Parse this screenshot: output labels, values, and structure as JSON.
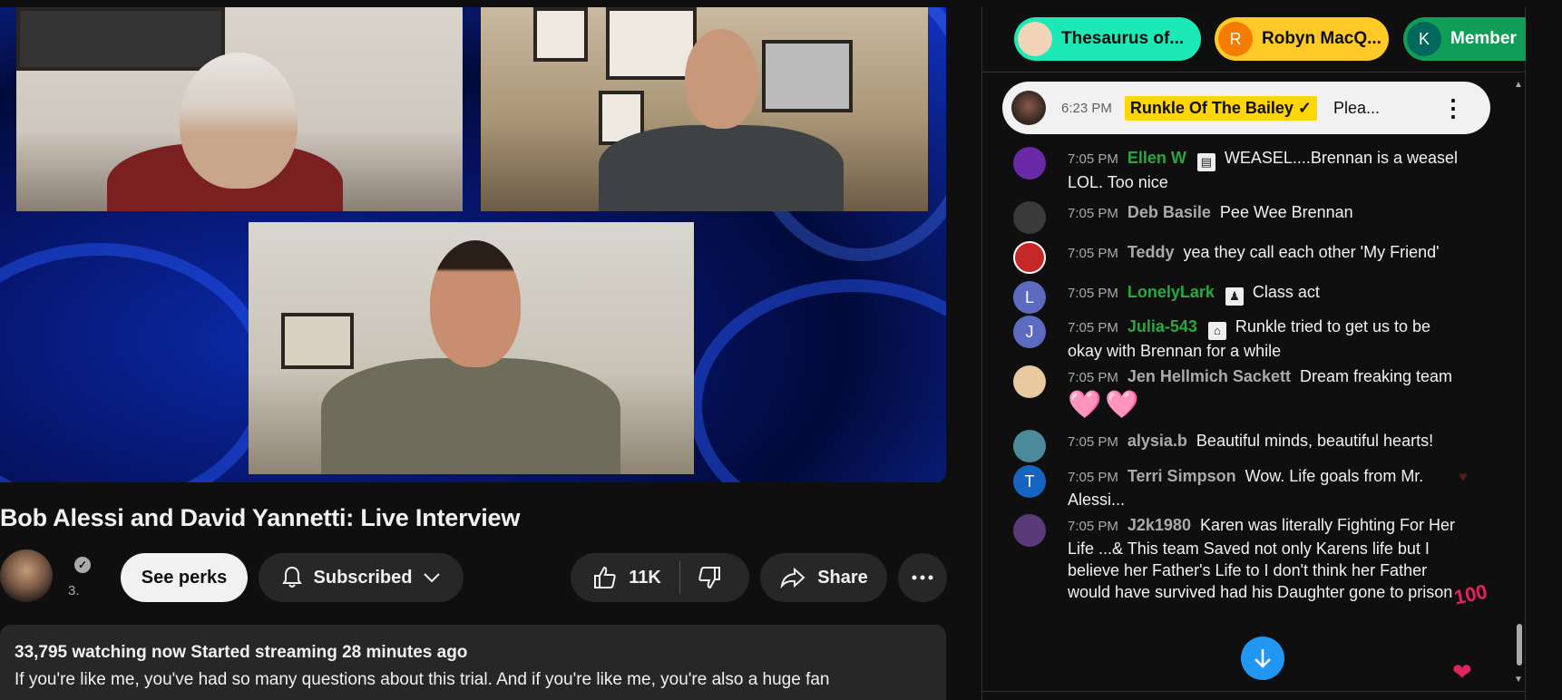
{
  "video": {
    "title": "Bob Alessi and David Yannetti: Live Interview",
    "channel_subs_fragment": "3.",
    "see_perks_label": "See perks",
    "subscribed_label": "Subscribed",
    "like_count": "11K",
    "share_label": "Share",
    "description": {
      "stats": "33,795 watching now  Started streaming 28 minutes ago",
      "text": "If you're like me, you've had so many questions about this trial.  And if you're like me, you're also a huge fan"
    }
  },
  "chat": {
    "chips": [
      {
        "label": "Thesaurus of...",
        "initial": ""
      },
      {
        "label": "Robyn MacQ...",
        "initial": "R"
      },
      {
        "label": "Member",
        "initial": "K"
      }
    ],
    "pinned": {
      "time": "6:23 PM",
      "author": "Runkle Of The Bailey ✓",
      "text": "Plea..."
    },
    "messages": [
      {
        "time": "7:05 PM",
        "author": "Ellen W",
        "badge": "▤",
        "text": "WEASEL....Brennan is a weasel LOL. Too nice",
        "avatar_initial": "",
        "avatar_color": "#6a2aa8",
        "member": true
      },
      {
        "time": "7:05 PM",
        "author": "Deb Basile",
        "text": "Pee Wee Brennan",
        "avatar_initial": "",
        "avatar_color": "#3a3a3a",
        "member": false
      },
      {
        "time": "7:05 PM",
        "author": "Teddy",
        "text": "yea they call each other 'My Friend'",
        "avatar_initial": "",
        "avatar_color": "#c62828",
        "member": false
      },
      {
        "time": "7:05 PM",
        "author": "LonelyLark",
        "badge": "♟",
        "text": "Class act",
        "avatar_initial": "L",
        "avatar_color": "#5c6bc0",
        "member": true
      },
      {
        "time": "7:05 PM",
        "author": "Julia-543",
        "badge": "⌂",
        "text": "Runkle tried to get us to be okay with Brennan for a while",
        "avatar_initial": "J",
        "avatar_color": "#5c6bc0",
        "member": true
      },
      {
        "time": "7:05 PM",
        "author": "Jen Hellmich Sackett",
        "text": "Dream freaking team",
        "avatar_initial": "",
        "avatar_color": "#e8c9a0",
        "member": false
      },
      {
        "time": "7:05 PM",
        "author": "alysia.b",
        "text": "Beautiful minds, beautiful hearts!",
        "avatar_initial": "",
        "avatar_color": "#4a8a9a",
        "member": false
      },
      {
        "time": "7:05 PM",
        "author": "Terri Simpson",
        "text": "Wow. Life goals from Mr. Alessi...",
        "avatar_initial": "T",
        "avatar_color": "#1565c0",
        "member": false
      },
      {
        "time": "7:05 PM",
        "author": "J2k1980",
        "text": "Karen was literally Fighting For Her Life ...& This team Saved not only Karens life but I believe her Father's Life to I don't think her Father would have survived had his Daughter gone to prison",
        "avatar_initial": "",
        "avatar_color": "#5a3a7a",
        "member": false
      }
    ],
    "pink_hearts": "🩷",
    "reaction_100": "100"
  }
}
